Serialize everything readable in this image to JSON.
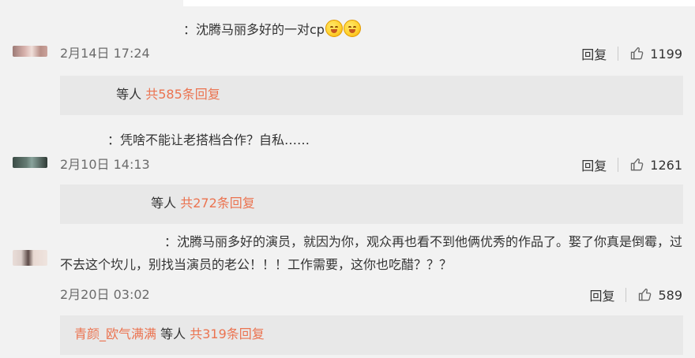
{
  "comments": [
    {
      "text": "：沈腾马丽多好的一对cp",
      "emoji": [
        "😂",
        "😂"
      ],
      "timestamp": "2月14日 17:24",
      "reply_label": "回复",
      "likes": "1199",
      "reply_box": {
        "names": "",
        "suffix": "等人",
        "count_text": "共585条回复"
      }
    },
    {
      "text": "：凭啥不能让老搭档合作？自私……",
      "timestamp": "2月10日 14:13",
      "reply_label": "回复",
      "likes": "1261",
      "reply_box": {
        "names": "",
        "suffix": "等人",
        "count_text": "共272条回复"
      }
    },
    {
      "text": "：沈腾马丽多好的演员，就因为你，观众再也看不到他俩优秀的作品了。娶了你真是倒霉，过不去这个坎儿，别找当演员的老公！！！工作需要，这你也吃醋？？？",
      "timestamp": "2月20日 03:02",
      "reply_label": "回复",
      "likes": "589",
      "reply_box": {
        "names": "青颜_欧气满满",
        "suffix": "等人",
        "count_text": "共319条回复"
      }
    }
  ],
  "colors": {
    "link": "#eb7350",
    "background": "#f2f2f2",
    "reply_box": "#e8e8e8",
    "text": "#333333",
    "muted": "#6b6b6b"
  },
  "icons": {
    "like": "thumbs-up-icon"
  }
}
